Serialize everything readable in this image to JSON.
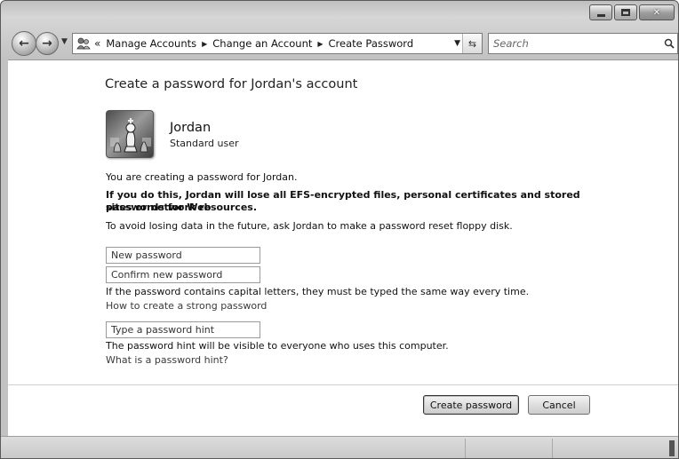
{
  "window": {
    "caption_buttons": [
      "minimize",
      "maximize",
      "close"
    ]
  },
  "navigation": {
    "back_icon": "back-arrow-icon",
    "forward_icon": "forward-arrow-icon",
    "breadcrumb_overflow": "«",
    "breadcrumbs": [
      "Manage Accounts",
      "Change an Account",
      "Create Password"
    ],
    "search_placeholder": "Search"
  },
  "page": {
    "title": "Create a password for Jordan's account",
    "user": {
      "name": "Jordan",
      "type": "Standard user"
    },
    "info_line": "You are creating a password for Jordan.",
    "warning_line1": "If you do this, Jordan will lose all EFS-encrypted files, personal certificates and stored passwords for Web",
    "warning_line2": "sites or network resources.",
    "advice": "To avoid losing data in the future, ask Jordan to make a password reset floppy disk.",
    "fields": {
      "new_password_placeholder": "New password",
      "confirm_password_placeholder": "Confirm new password",
      "hint_placeholder": "Type a password hint"
    },
    "case_note": "If the password contains capital letters, they must be typed the same way every time.",
    "strong_password_link": "How to create a strong password",
    "hint_note": "The password hint will be visible to everyone who uses this computer.",
    "hint_link": "What is a password hint?",
    "buttons": {
      "create": "Create password",
      "cancel": "Cancel"
    }
  }
}
